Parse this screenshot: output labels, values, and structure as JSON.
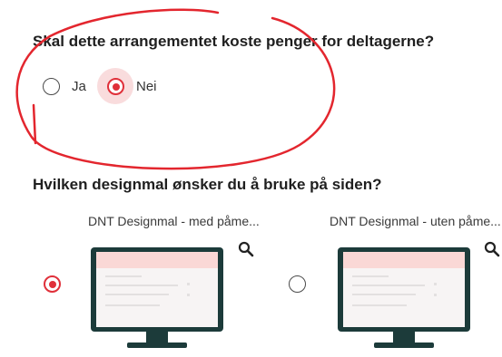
{
  "question1": {
    "text": "Skal dette arrangementet koste penger for deltagerne?",
    "options": [
      {
        "label": "Ja",
        "selected": false
      },
      {
        "label": "Nei",
        "selected": true
      }
    ]
  },
  "question2": {
    "text": "Hvilken designmal ønsker du å bruke på siden?",
    "cards": [
      {
        "title": "DNT Designmal - med påme...",
        "selected": true,
        "icon": "search-icon"
      },
      {
        "title": "DNT Designmal - uten påme...",
        "selected": false,
        "icon": "search-icon"
      }
    ]
  },
  "colors": {
    "accent": "#e0303a",
    "annotation": "#e3262e",
    "monitor": "#1c3b3a",
    "screen_header": "#fad8d6"
  }
}
